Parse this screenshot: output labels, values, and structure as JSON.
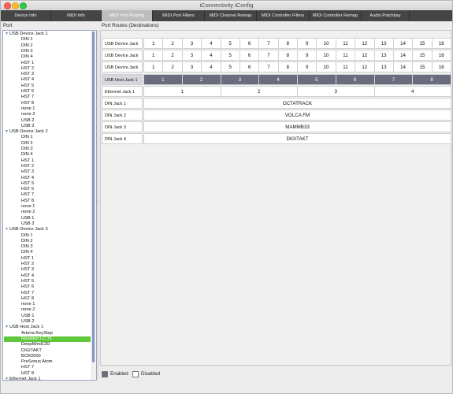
{
  "window": {
    "title": "iConnectivity iConfig"
  },
  "tabs": [
    {
      "label": "Device Info",
      "active": false
    },
    {
      "label": "MIDI Info",
      "active": false
    },
    {
      "label": "MIDI Port Routing",
      "active": true
    },
    {
      "label": "MIDI Port Filters",
      "active": false
    },
    {
      "label": "MIDI Channel Remap",
      "active": false
    },
    {
      "label": "MIDI Controller Filters",
      "active": false
    },
    {
      "label": "MIDI Controller Remap",
      "active": false
    },
    {
      "label": "Audio Patchbay",
      "active": false
    }
  ],
  "left_header": "Port",
  "right_header": "Port Routes (Destinations)",
  "tree": [
    {
      "label": "USB Device Jack 1",
      "children": [
        "DIN 1",
        "DIN 2",
        "DIN 3",
        "DIN 4",
        "HST 1",
        "HST 2",
        "HST 3",
        "HST 4",
        "HST 5",
        "HST 6",
        "HST 7",
        "HST 8",
        "none 1",
        "none 2",
        "USB 2",
        "USB 3"
      ]
    },
    {
      "label": "USB Device Jack 2",
      "children": [
        "DIN 1",
        "DIN 2",
        "DIN 3",
        "DIN 4",
        "HST 1",
        "HST 2",
        "HST 3",
        "HST 4",
        "HST 5",
        "HST 6",
        "HST 7",
        "HST 8",
        "none 1",
        "none 2",
        "USB 1",
        "USB 3"
      ]
    },
    {
      "label": "USB Device Jack 3",
      "children": [
        "DIN 1",
        "DIN 2",
        "DIN 3",
        "DIN 4",
        "HST 1",
        "HST 2",
        "HST 3",
        "HST 4",
        "HST 5",
        "HST 6",
        "HST 7",
        "HST 8",
        "none 1",
        "none 2",
        "USB 1",
        "USB 2"
      ]
    },
    {
      "label": "USB Host Jack 1",
      "children": [
        "Arturia KeyStep",
        "Novation LC XL",
        "DeepMind12D",
        "DIGITAKT",
        "BCR2000",
        "PreSonus Atom",
        "HST 7",
        "HST 8"
      ]
    },
    {
      "label": "Ethernet Jack 1",
      "children": []
    }
  ],
  "selected_item": "Novation LC XL",
  "routes": {
    "rows": [
      {
        "label": "USB Device Jack 1",
        "cells": [
          "1",
          "2",
          "3",
          "4",
          "5",
          "6",
          "7",
          "8",
          "9",
          "10",
          "11",
          "12",
          "13",
          "14",
          "15",
          "16"
        ],
        "enabled": false
      },
      {
        "label": "USB Device Jack 2",
        "cells": [
          "1",
          "2",
          "3",
          "4",
          "5",
          "6",
          "7",
          "8",
          "9",
          "10",
          "11",
          "12",
          "13",
          "14",
          "15",
          "16"
        ],
        "enabled": false
      },
      {
        "label": "USB Device Jack 3",
        "cells": [
          "1",
          "2",
          "3",
          "4",
          "5",
          "6",
          "7",
          "8",
          "9",
          "10",
          "11",
          "12",
          "13",
          "14",
          "15",
          "16"
        ],
        "enabled": false
      },
      {
        "label": "USB Host Jack 1",
        "cells": [
          "1",
          "2",
          "3",
          "4",
          "5",
          "6",
          "7",
          "8"
        ],
        "enabled": true
      },
      {
        "label": "Ethernet Jack 1",
        "cells": [
          "1",
          "2",
          "3",
          "4"
        ],
        "enabled": false
      },
      {
        "label": "DIN Jack 1",
        "cells": [
          "OCTATRACK"
        ],
        "enabled": false
      },
      {
        "label": "DIN Jack 2",
        "cells": [
          "VOLCA FM"
        ],
        "enabled": false
      },
      {
        "label": "DIN Jack 3",
        "cells": [
          "MAMMB33"
        ],
        "enabled": false
      },
      {
        "label": "DIN Jack 4",
        "cells": [
          "DIGITAKT"
        ],
        "enabled": false
      }
    ]
  },
  "legend": {
    "enabled_label": "Enabled",
    "disabled_label": "Disabled",
    "enabled_color": "#6a6b7c",
    "disabled_color": "#ffffff"
  },
  "colors": {
    "selection": "#5ec73a",
    "tab_bar": "#454545",
    "scroll_thumb": "#7f96c9"
  }
}
